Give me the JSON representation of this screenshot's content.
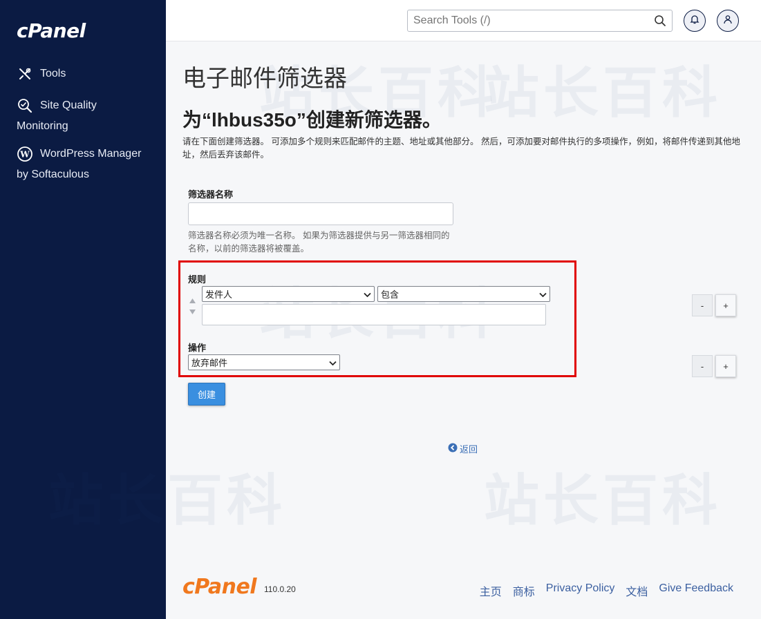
{
  "sidebar": {
    "brand": "cPanel",
    "items": [
      {
        "label": "Tools",
        "icon": "tools-icon"
      },
      {
        "label": "Site Quality",
        "label2": "Monitoring",
        "icon": "site-quality-icon"
      },
      {
        "label": "WordPress Manager",
        "label2": "by Softaculous",
        "icon": "wordpress-icon"
      }
    ]
  },
  "header": {
    "search_placeholder": "Search Tools (/)"
  },
  "main": {
    "page_title": "电子邮件筛选器",
    "sub_title": "为“lhbus35o”创建新筛选器。",
    "description": "请在下面创建筛选器。 可添加多个规则来匹配邮件的主题、地址或其他部分。 然后，可添加要对邮件执行的多项操作，例如，将邮件传递到其他地址，然后丢弃该邮件。",
    "filter_name_label": "筛选器名称",
    "filter_name_value": "",
    "filter_name_help": "筛选器名称必须为唯一名称。 如果为筛选器提供与另一筛选器相同的名称，以前的筛选器将被覆盖。",
    "rules_label": "规则",
    "rule_field": "发件人",
    "rule_match": "包含",
    "rule_value": "",
    "action_label": "操作",
    "action_value": "放弃邮件",
    "remove_label": "-",
    "add_label": "+",
    "create_button": "创建",
    "back_link": "返回"
  },
  "footer": {
    "logo": "cPanel",
    "version": "110.0.20",
    "links": [
      "主页",
      "商标",
      "Privacy Policy",
      "文档",
      "Give Feedback"
    ]
  },
  "colors": {
    "sidebar_bg": "#0b1b43",
    "accent_blue": "#3a8fe0",
    "highlight_red": "#e00000",
    "footer_logo_orange": "#f0781e"
  }
}
